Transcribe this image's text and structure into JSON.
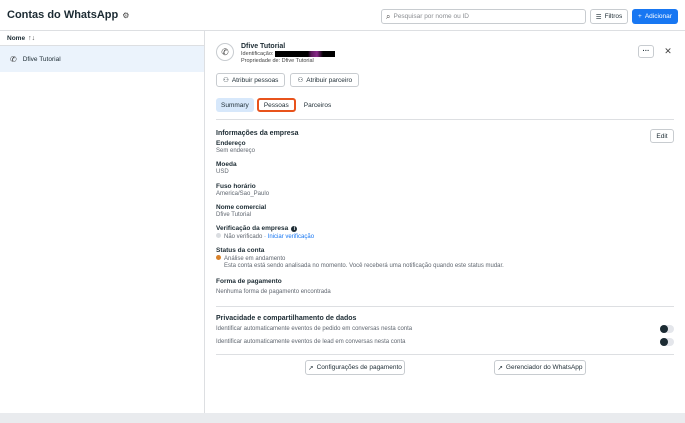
{
  "header": {
    "title": "Contas do WhatsApp",
    "search_placeholder": "Pesquisar por nome ou ID",
    "filters_label": "Filtros",
    "add_label": "Adicionar"
  },
  "list": {
    "column_name": "Nome",
    "sort_glyph": "↑↓",
    "items": [
      {
        "label": "Dfive Tutorial"
      }
    ]
  },
  "detail": {
    "name": "Dfive Tutorial",
    "id_label": "Identificação:",
    "owner_label": "Propriedade de: Dfive Tutorial",
    "more_label": "···",
    "assign_people": "Atribuir pessoas",
    "assign_partner": "Atribuir parceiro",
    "tabs": [
      {
        "label": "Summary"
      },
      {
        "label": "Pessoas"
      },
      {
        "label": "Parceiros"
      }
    ],
    "company_info_title": "Informações da empresa",
    "edit_label": "Edit",
    "address_label": "Endereço",
    "address_value": "Sem endereço",
    "currency_label": "Moeda",
    "currency_value": "USD",
    "timezone_label": "Fuso horário",
    "timezone_value": "America/Sao_Paulo",
    "trade_name_label": "Nome comercial",
    "trade_name_value": "Dfive Tutorial",
    "verification_label": "Verificação da empresa",
    "verification_status": "Não verificado",
    "verification_link": "· Iniciar verificação",
    "account_status_label": "Status da conta",
    "account_status_value": "Análise em andamento",
    "account_status_note": "Esta conta está sendo analisada no momento. Você receberá uma notificação quando este status mudar.",
    "payment_label": "Forma de pagamento",
    "payment_value": "Nenhuma forma de pagamento encontrada",
    "privacy_title": "Privacidade e compartilhamento de dados",
    "privacy_order": "Identificar automaticamente eventos de pedido em conversas nesta conta",
    "privacy_lead": "Identificar automaticamente eventos de lead em conversas nesta conta",
    "payment_settings_btn": "Configurações de pagamento",
    "whatsapp_manager_btn": "Gerenciador do WhatsApp"
  },
  "colors": {
    "accent": "#1877f2",
    "highlight": "#e8531c",
    "tab_active_bg": "#d7e8fb",
    "status_orange": "#d9822b"
  }
}
